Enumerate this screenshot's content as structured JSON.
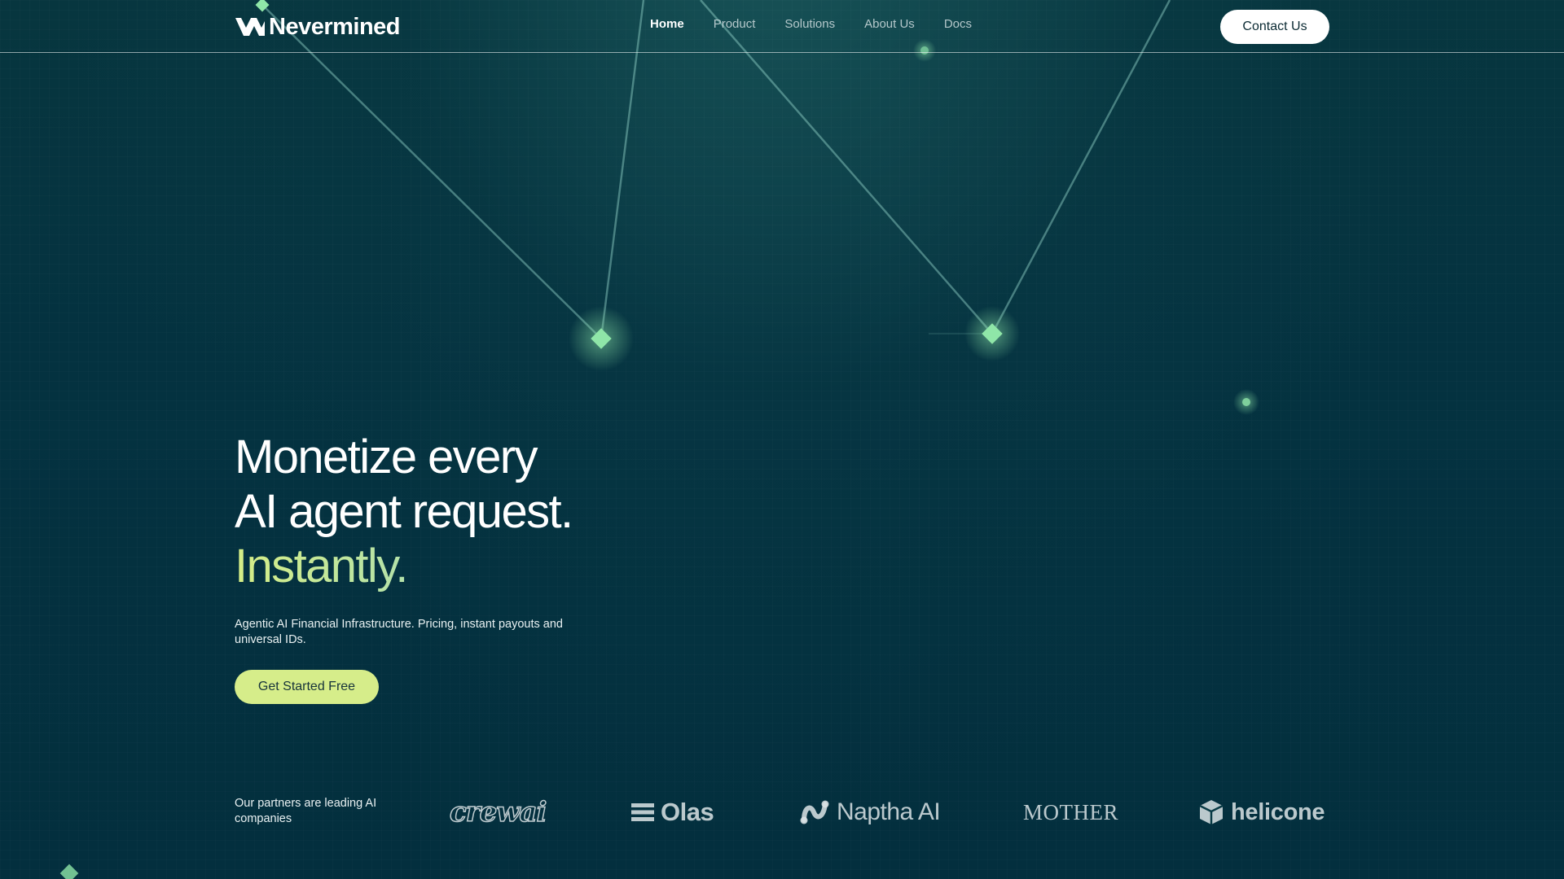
{
  "brand": {
    "name": "Nevermined",
    "accent": "#d6ed8a",
    "background": "#042f3b"
  },
  "nav": {
    "items": [
      {
        "label": "Home",
        "active": true
      },
      {
        "label": "Product",
        "active": false
      },
      {
        "label": "Solutions",
        "active": false
      },
      {
        "label": "About Us",
        "active": false
      },
      {
        "label": "Docs",
        "active": false
      }
    ],
    "contact_label": "Contact Us"
  },
  "hero": {
    "line1": "Monetize every",
    "line2": "AI agent request.",
    "line3": "Instantly.",
    "subtitle": "Agentic AI Financial Infrastructure. Pricing, instant payouts and universal IDs.",
    "cta_label": "Get Started Free"
  },
  "partners": {
    "label": "Our partners are leading AI companies",
    "logos": [
      {
        "name": "crewai",
        "icon": "crewai-logo"
      },
      {
        "name": "Olas",
        "icon": "olas-logo"
      },
      {
        "name": "Naptha AI",
        "icon": "naptha-logo"
      },
      {
        "name": "MOTHER",
        "icon": "mother-logo"
      },
      {
        "name": "helicone",
        "icon": "helicone-logo"
      }
    ]
  }
}
